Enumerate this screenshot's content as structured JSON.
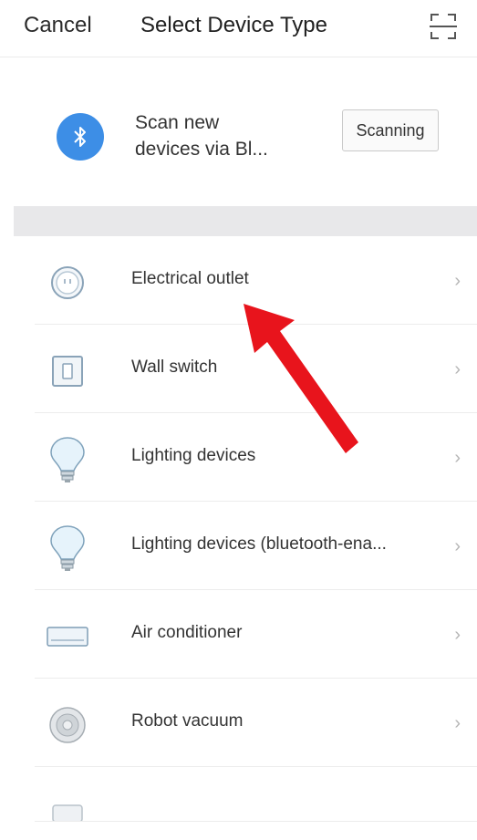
{
  "header": {
    "cancel_label": "Cancel",
    "title": "Select Device Type",
    "scan_icon": "scan-qr-icon"
  },
  "bluetooth": {
    "icon": "bluetooth-icon",
    "text_line1": "Scan new",
    "text_line2": "devices via Bl...",
    "button_label": "Scanning"
  },
  "devices": [
    {
      "label": "Electrical outlet",
      "icon": "outlet-icon"
    },
    {
      "label": "Wall switch",
      "icon": "wall-switch-icon"
    },
    {
      "label": "Lighting devices",
      "icon": "bulb-icon"
    },
    {
      "label": "Lighting devices (bluetooth-ena...",
      "icon": "bulb-icon"
    },
    {
      "label": "Air conditioner",
      "icon": "air-conditioner-icon"
    },
    {
      "label": "Robot vacuum",
      "icon": "robot-vacuum-icon"
    }
  ],
  "chevron": "›",
  "colors": {
    "bluetooth_blue": "#3d8ee6",
    "annotation_arrow": "#e8141c",
    "separator_band": "#e8e8ea"
  }
}
